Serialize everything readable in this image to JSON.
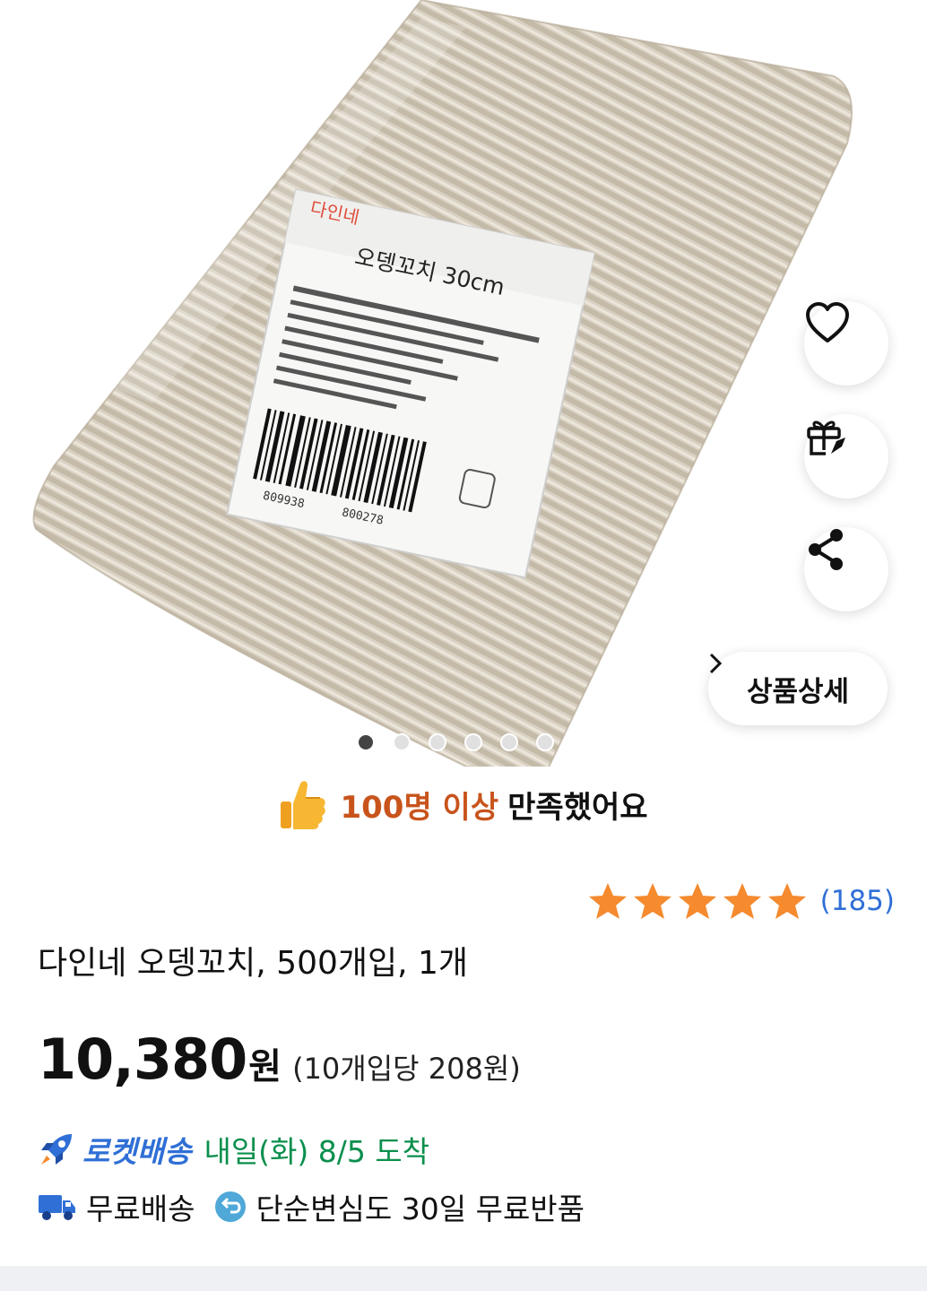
{
  "product_label": {
    "brand": "다인네",
    "name": "오뎅꼬치 30cm",
    "barcode_left": "809938",
    "barcode_right": "800278"
  },
  "actions": {
    "wishlist_icon": "heart-icon",
    "gift_icon": "gift-icon",
    "share_icon": "share-icon",
    "detail_label": "상품상세"
  },
  "carousel": {
    "total": 6,
    "active_index": 0
  },
  "satisfaction": {
    "highlight": "100명 이상",
    "rest": "만족했어요"
  },
  "rating": {
    "stars": 5,
    "count": "(185)"
  },
  "product": {
    "title": "다인네 오뎅꼬치, 500개입, 1개",
    "price": "10,380",
    "currency": "원",
    "unit_price": "(10개입당 208원)"
  },
  "delivery": {
    "label": "로켓배송",
    "date": "내일(화) 8/5 도착"
  },
  "benefits": {
    "free_shipping": "무료배송",
    "free_return": "단순변심도 30일 무료반품"
  },
  "colors": {
    "accent_blue": "#2f6fd6",
    "delivery_green": "#0a8f4d",
    "star_orange": "#f58a2e",
    "satisfaction_orange": "#c8541c"
  }
}
